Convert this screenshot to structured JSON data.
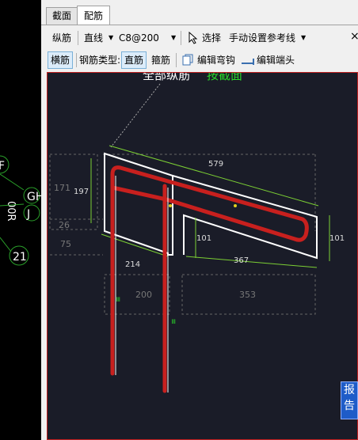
{
  "left_labels": {
    "f": "F",
    "gh": "GH",
    "j": "J",
    "num": "21",
    "vert": "00R"
  },
  "tabs": [
    {
      "label": "截面"
    },
    {
      "label": "配筋"
    }
  ],
  "toolbar1": {
    "bar_type": "纵筋",
    "line_mode": "直线",
    "spec": "C8@200",
    "select": "选择",
    "ref_line": "手动设置参考线",
    "close": "×"
  },
  "toolbar2": {
    "horizontal": "横筋",
    "bar_type_label": "钢筋类型:",
    "straight": "直筋",
    "stirrup": "箍筋",
    "edit_hook": "编辑弯钩",
    "edit_end": "编辑端头"
  },
  "canvas": {
    "title_white": "全部纵筋",
    "title_green": "按截面",
    "dims": {
      "d579": "579",
      "d197": "197",
      "d171": "171",
      "d26": "26",
      "d75": "75",
      "d214": "214",
      "d101a": "101",
      "d367": "367",
      "d101b": "101",
      "d200": "200",
      "d353": "353"
    }
  },
  "report_button": {
    "line1": "报",
    "line2": "告"
  },
  "colors": {
    "rebar": "#c8201e",
    "dimension": "#7cd034",
    "outline": "#ffffff",
    "canvas_bg": "#1a1c28"
  }
}
